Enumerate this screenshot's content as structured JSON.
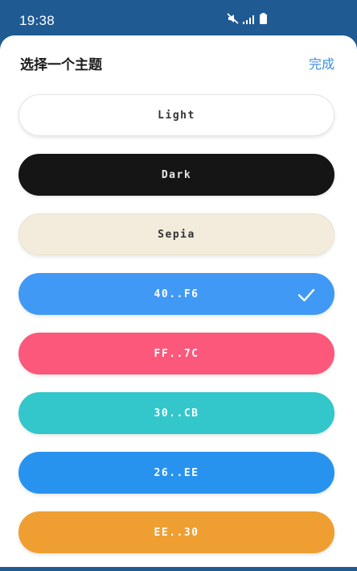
{
  "status_bar": {
    "time": "19:38",
    "icons": [
      "mute-icon",
      "signal-icon",
      "battery-icon"
    ]
  },
  "header": {
    "title": "选择一个主题",
    "done_label": "完成"
  },
  "themes": [
    {
      "label": "Light",
      "bg": "#ffffff",
      "fg": "#333333",
      "border": "#e4e4e4",
      "selected": false
    },
    {
      "label": "Dark",
      "bg": "#151515",
      "fg": "#e6e6e6",
      "border": "#151515",
      "selected": false
    },
    {
      "label": "Sepia",
      "bg": "#f3ecdd",
      "fg": "#333333",
      "border": "#ece3cf",
      "selected": false
    },
    {
      "label": "40..F6",
      "bg": "#4099f5",
      "fg": "#ffffff",
      "border": "#4099f5",
      "selected": true
    },
    {
      "label": "FF..7C",
      "bg": "#fc587b",
      "fg": "#ffffff",
      "border": "#fc587b",
      "selected": false
    },
    {
      "label": "30..CB",
      "bg": "#33c6cb",
      "fg": "#ffffff",
      "border": "#33c6cb",
      "selected": false
    },
    {
      "label": "26..EE",
      "bg": "#2893ef",
      "fg": "#ffffff",
      "border": "#2893ef",
      "selected": false
    },
    {
      "label": "EE..30",
      "bg": "#ef9f31",
      "fg": "#ffffff",
      "border": "#ef9f31",
      "selected": false
    }
  ]
}
